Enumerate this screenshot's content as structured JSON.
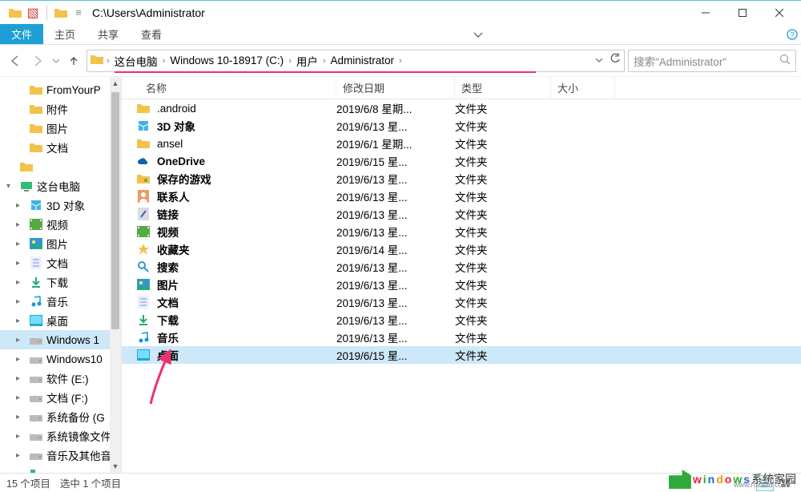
{
  "window": {
    "title_path": "C:\\Users\\Administrator"
  },
  "ribbon": {
    "file": "文件",
    "home": "主页",
    "share": "共享",
    "view": "查看"
  },
  "breadcrumbs": [
    "这台电脑",
    "Windows 10-18917 (C:)",
    "用户",
    "Administrator"
  ],
  "search": {
    "placeholder": "搜索\"Administrator\""
  },
  "nav": {
    "items": [
      {
        "label": "FromYourP",
        "indent": 1,
        "icon": "folder",
        "tw": ""
      },
      {
        "label": "附件",
        "indent": 1,
        "icon": "folder",
        "tw": ""
      },
      {
        "label": "图片",
        "indent": 1,
        "icon": "folder",
        "tw": ""
      },
      {
        "label": "文档",
        "indent": 1,
        "icon": "folder",
        "tw": ""
      },
      {
        "label": "",
        "indent": 0,
        "icon": "none",
        "tw": ""
      },
      {
        "label": "这台电脑",
        "indent": 0,
        "icon": "pc",
        "tw": "▾"
      },
      {
        "label": "3D 对象",
        "indent": 1,
        "icon": "3d",
        "tw": "▸"
      },
      {
        "label": "视频",
        "indent": 1,
        "icon": "video",
        "tw": "▸"
      },
      {
        "label": "图片",
        "indent": 1,
        "icon": "pic",
        "tw": "▸"
      },
      {
        "label": "文档",
        "indent": 1,
        "icon": "doc",
        "tw": "▸"
      },
      {
        "label": "下载",
        "indent": 1,
        "icon": "down",
        "tw": "▸"
      },
      {
        "label": "音乐",
        "indent": 1,
        "icon": "music",
        "tw": "▸"
      },
      {
        "label": "桌面",
        "indent": 1,
        "icon": "desk",
        "tw": "▸"
      },
      {
        "label": "Windows 1",
        "indent": 1,
        "icon": "drive",
        "tw": "▸",
        "sel": true
      },
      {
        "label": "Windows10",
        "indent": 1,
        "icon": "drive",
        "tw": "▸"
      },
      {
        "label": "软件 (E:)",
        "indent": 1,
        "icon": "drive",
        "tw": "▸"
      },
      {
        "label": "文档 (F:)",
        "indent": 1,
        "icon": "drive",
        "tw": "▸"
      },
      {
        "label": "系统备份 (G",
        "indent": 1,
        "icon": "drive",
        "tw": "▸"
      },
      {
        "label": "系统镜像文件",
        "indent": 1,
        "icon": "drive",
        "tw": "▸"
      },
      {
        "label": "音乐及其他音",
        "indent": 1,
        "icon": "drive",
        "tw": "▸"
      },
      {
        "label": "⋯",
        "indent": 1,
        "icon": "net",
        "tw": "▸"
      }
    ]
  },
  "columns": {
    "name": "名称",
    "date": "修改日期",
    "type": "类型",
    "size": "大小"
  },
  "rows": [
    {
      "name": ".android",
      "date": "2019/6/8 星期...",
      "type": "文件夹",
      "icon": "folder",
      "bold": false
    },
    {
      "name": "3D 对象",
      "date": "2019/6/13 星...",
      "type": "文件夹",
      "icon": "3d",
      "bold": true
    },
    {
      "name": "ansel",
      "date": "2019/6/1 星期...",
      "type": "文件夹",
      "icon": "folder",
      "bold": false
    },
    {
      "name": "OneDrive",
      "date": "2019/6/15 星...",
      "type": "文件夹",
      "icon": "cloud",
      "bold": true
    },
    {
      "name": "保存的游戏",
      "date": "2019/6/13 星...",
      "type": "文件夹",
      "icon": "games",
      "bold": true
    },
    {
      "name": "联系人",
      "date": "2019/6/13 星...",
      "type": "文件夹",
      "icon": "contacts",
      "bold": true
    },
    {
      "name": "链接",
      "date": "2019/6/13 星...",
      "type": "文件夹",
      "icon": "links",
      "bold": true
    },
    {
      "name": "视频",
      "date": "2019/6/13 星...",
      "type": "文件夹",
      "icon": "video",
      "bold": true
    },
    {
      "name": "收藏夹",
      "date": "2019/6/14 星...",
      "type": "文件夹",
      "icon": "fav",
      "bold": true
    },
    {
      "name": "搜索",
      "date": "2019/6/13 星...",
      "type": "文件夹",
      "icon": "search",
      "bold": true
    },
    {
      "name": "图片",
      "date": "2019/6/13 星...",
      "type": "文件夹",
      "icon": "pic",
      "bold": true
    },
    {
      "name": "文档",
      "date": "2019/6/13 星...",
      "type": "文件夹",
      "icon": "doc",
      "bold": true
    },
    {
      "name": "下载",
      "date": "2019/6/13 星...",
      "type": "文件夹",
      "icon": "down",
      "bold": true
    },
    {
      "name": "音乐",
      "date": "2019/6/13 星...",
      "type": "文件夹",
      "icon": "music",
      "bold": true
    },
    {
      "name": "桌面",
      "date": "2019/6/15 星...",
      "type": "文件夹",
      "icon": "desk",
      "bold": true,
      "sel": true
    }
  ],
  "status": {
    "count": "15 个项目",
    "selection": "选中 1 个项目"
  },
  "watermark": {
    "text_parts": [
      "w",
      "i",
      "n",
      "d",
      "o",
      "w",
      "s"
    ],
    "suffix": "系统家园",
    "sub": "www.ruitaifu.com"
  },
  "icons": {
    "folder_color": "#f3c24a",
    "accent": "#1e9fd6"
  }
}
